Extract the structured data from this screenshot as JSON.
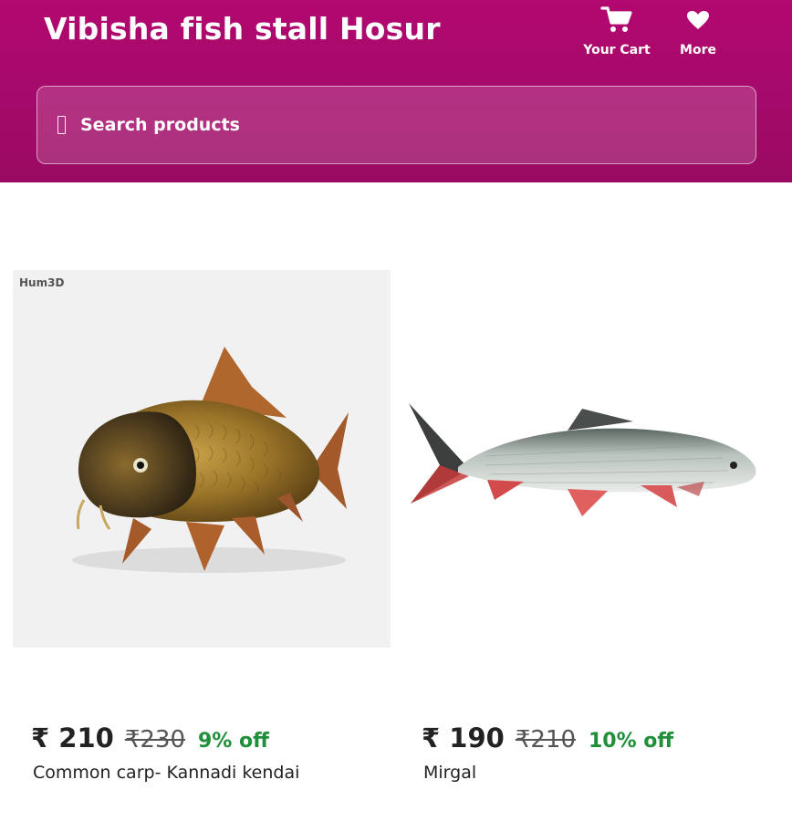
{
  "header": {
    "title": "Vibisha fish stall Hosur",
    "cart_label": "Your Cart",
    "more_label": "More",
    "cart_icon": "cart-icon",
    "more_icon": "heart-icon"
  },
  "search": {
    "placeholder": "Search products",
    "icon": "search-icon"
  },
  "products": [
    {
      "name": "Common carp- Kannadi kendai",
      "price": "₹ 210",
      "mrp": "₹230",
      "discount": "9% off",
      "image_watermark": "Hum3D"
    },
    {
      "name": "Mirgal",
      "price": "₹ 190",
      "mrp": "₹210",
      "discount": "10% off"
    }
  ],
  "colors": {
    "header_bg": "#a30a69",
    "discount_text": "#1f8f3a"
  }
}
